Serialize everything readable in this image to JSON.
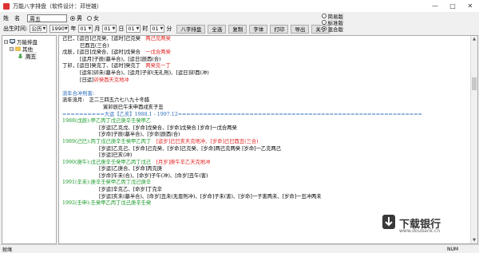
{
  "window": {
    "title": "万能八字排盘（软件设计：邓世雄）",
    "buttons": [
      "—",
      "□",
      "✕"
    ]
  },
  "form": {
    "name_label": "姓　名",
    "name_value": "周五",
    "gender": [
      {
        "label": "男",
        "checked": true
      },
      {
        "label": "女",
        "checked": false
      }
    ],
    "birth_label": "出生时间:",
    "calendar": "公历",
    "year": "1990",
    "year_unit": "年",
    "month": "01",
    "month_unit": "月",
    "day": "01",
    "day_unit": "日",
    "hour": "01",
    "hour_unit": "时",
    "minute": "01",
    "minute_unit": "分",
    "buttons": [
      "八字排盘",
      "全选",
      "复制",
      "字体",
      "打印",
      "导出",
      "关于"
    ],
    "modes": [
      {
        "label": "简易版",
        "checked": false
      },
      {
        "label": "标准版",
        "checked": false
      },
      {
        "label": "混合版",
        "checked": true
      }
    ]
  },
  "tree": {
    "root": "万能排盘",
    "child": "其他",
    "leaf": "周五"
  },
  "content": {
    "l1a": "己巳，[运日]己克癸、[运时]己克癸　",
    "l1b": "两己克两癸",
    "l2": "巳酉丑(三合)",
    "l3a": "戊辰，[运日]戊癸合、[运时]戊癸合　",
    "l3b": "一戊合两癸",
    "l4": "[运月]子辰(墓半合)、[运日]辰酉(合)",
    "l5a": "丁卯，[运日]癸克丁、[运时]癸克丁　",
    "l5b": "两癸克一丁",
    "l6": "[运年]卯未(墓半合)、[运月]子卯(无礼刑)、[运日]卯酉(冲)",
    "l7a": "[日运]",
    "l7b": "卯癸酉天克地冲",
    "l8": "流年合冲刑害:",
    "l9": "流年流月:　正二三四五六七八九十冬腊",
    "l10": "寅卯辰巳午未申酉戌亥子丑",
    "l11": "==========大运【乙亥】1988.1 - 1997.12==========================================================",
    "l12": "1988(戊辰):甲乙丙丁戊己庚辛壬癸甲乙",
    "l13": "[岁运]乙克戊、[岁命]戊癸合、[岁命]戊癸合 [岁命]一戊合两癸",
    "l14": "[岁命]子辰(墓半合)、[岁命]辰酉(合)",
    "l15a": "1989(己巳):丙丁戊己庚辛壬癸甲乙丙丁　",
    "l15b": "[运岁]己巳亥天克地冲、[岁命]己巳酉丑(三合)",
    "l16": "[岁运]乙克己、[岁命]己克癸、[岁命]己克癸、[岁命]两己克两癸 [岁命]一乙克两己",
    "l17": "[岁运]巳亥(冲)",
    "l18a": "1990(庚午):戊己庚辛壬癸甲乙丙丁戊己　",
    "l18b": "[月岁]庚午辛乙天克地冲",
    "l19": "[岁运]乙庚合、[岁命]丙克庚",
    "l20": "[岁命]午未(合)、[命岁]子午(冲)、[命岁]丑午(害)",
    "l21": "1991(辛未):庚辛壬癸甲乙丙丁戊己庚辛",
    "l22": "[岁运]辛克乙、[命岁]丁克辛",
    "l23": "[岁运]亥未(墓半合)、[命岁]丑未(无恩刑冲)、[岁命]子未(害)、[岁命]一子害两未、[岁命]一丑冲两未",
    "l24": "1992(壬申):壬癸甲乙丙丁戊己庚辛壬癸"
  },
  "status": {
    "left": "就绪",
    "right": "NUM"
  },
  "watermark": {
    "text": "下载银行",
    "url": "www.doubank.cn"
  }
}
